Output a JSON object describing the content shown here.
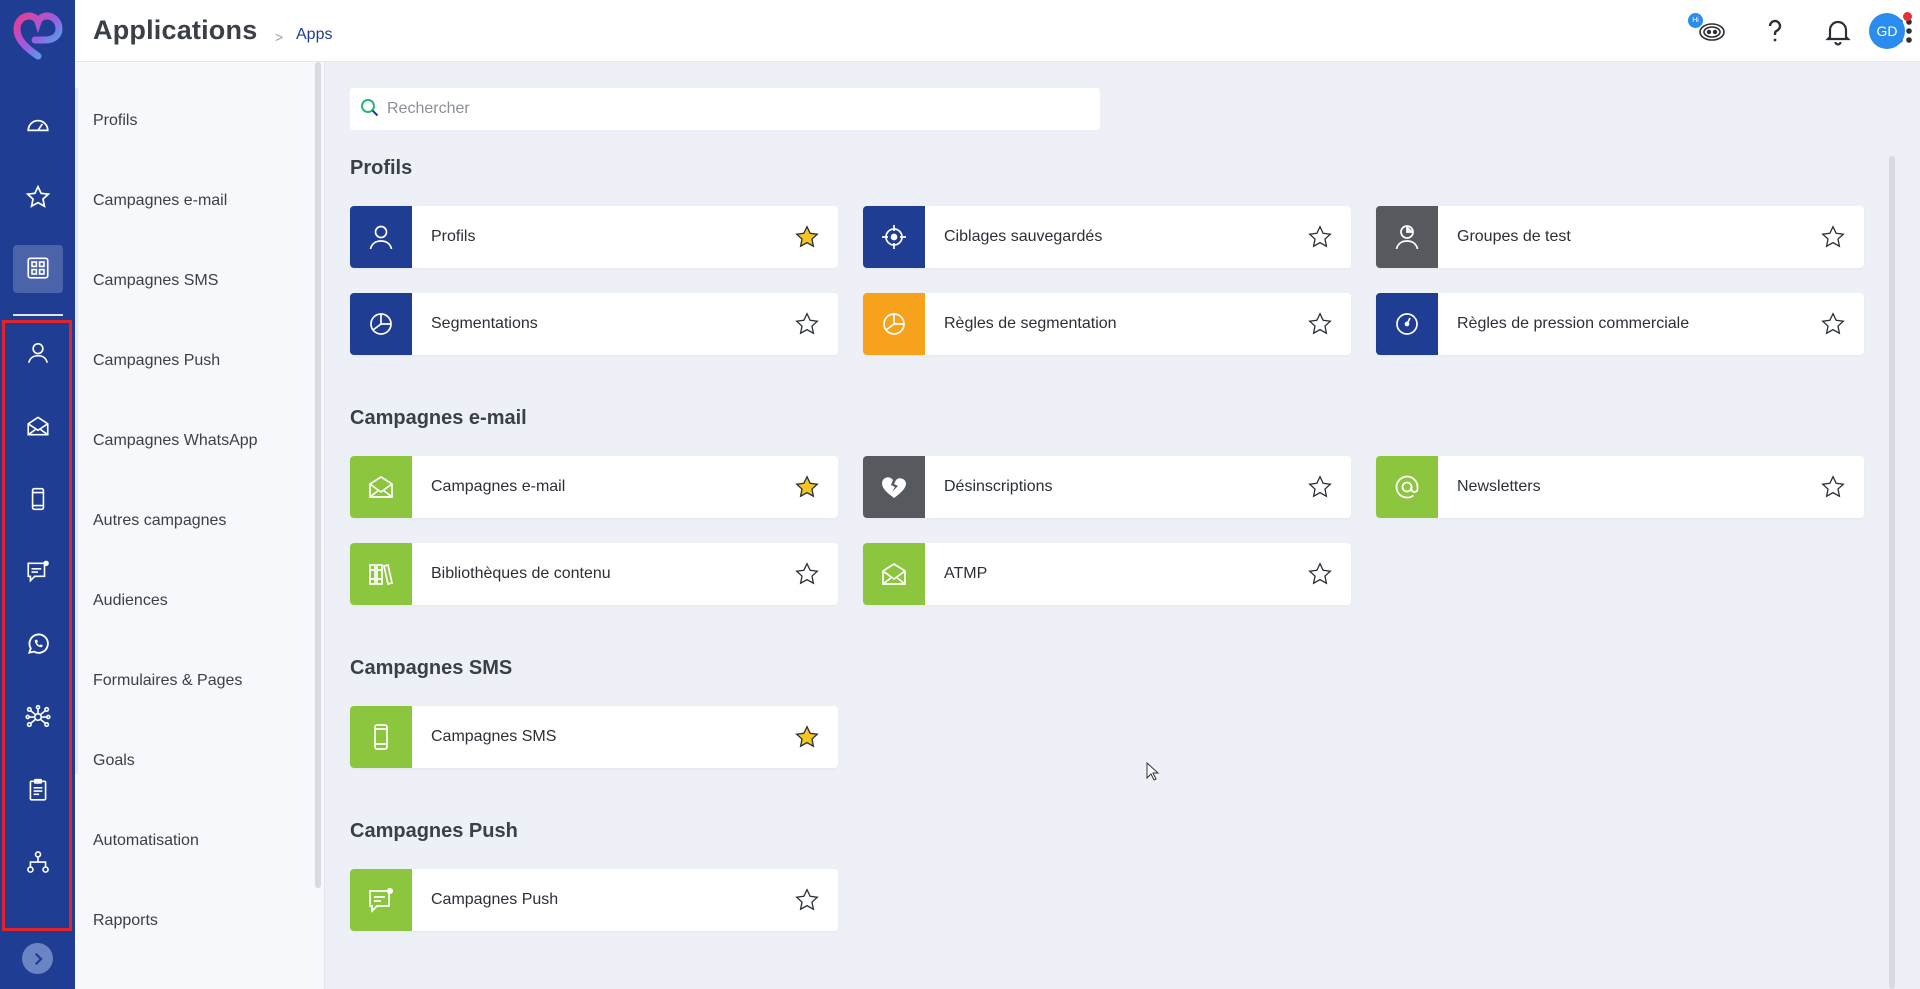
{
  "header": {
    "title": "Applications",
    "breadcrumb_sep": ">",
    "breadcrumb": "Apps",
    "hi_badge": "Hi",
    "avatar_initials": "GD",
    "icons": [
      "chatbot-icon",
      "help-icon",
      "bell-icon",
      "apps-grid-icon"
    ]
  },
  "rail": {
    "items": [
      "dashboard-icon",
      "star-icon",
      "apps-icon",
      "profile-icon",
      "email-icon",
      "mobile-icon",
      "push-icon",
      "whatsapp-icon",
      "audience-icon",
      "forms-icon",
      "automation-icon"
    ]
  },
  "categories": [
    "Profils",
    "Campagnes e-mail",
    "Campagnes SMS",
    "Campagnes Push",
    "Campagnes WhatsApp",
    "Autres campagnes",
    "Audiences",
    "Formulaires & Pages",
    "Goals",
    "Automatisation",
    "Rapports"
  ],
  "search": {
    "placeholder": "Rechercher",
    "value": ""
  },
  "colors": {
    "navy": "#1f3d92",
    "orange": "#f7a21d",
    "dark_gray": "#565a5e",
    "green": "#8cc63f",
    "star_fill": "#f3c623"
  },
  "sections": [
    {
      "title": "Profils",
      "cards": [
        {
          "label": "Profils",
          "icon": "user-icon",
          "color": "#1f3d92",
          "favorite": true
        },
        {
          "label": "Ciblages sauvegardés",
          "icon": "target-icon",
          "color": "#1f3d92",
          "favorite": false
        },
        {
          "label": "Groupes de test",
          "icon": "test-group-icon",
          "color": "#565a5e",
          "favorite": false
        },
        {
          "label": "Segmentations",
          "icon": "pie-icon",
          "color": "#1f3d92",
          "favorite": false
        },
        {
          "label": "Règles de segmentation",
          "icon": "pie-icon",
          "color": "#f7a21d",
          "favorite": false
        },
        {
          "label": "Règles de pression commerciale",
          "icon": "gauge-icon",
          "color": "#1f3d92",
          "favorite": false
        }
      ]
    },
    {
      "title": "Campagnes e-mail",
      "cards": [
        {
          "label": "Campagnes e-mail",
          "icon": "envelope-icon",
          "color": "#8cc63f",
          "favorite": true
        },
        {
          "label": "Désinscriptions",
          "icon": "broken-heart-icon",
          "color": "#565a5e",
          "favorite": false
        },
        {
          "label": "Newsletters",
          "icon": "at-icon",
          "color": "#8cc63f",
          "favorite": false
        },
        {
          "label": "Bibliothèques de contenu",
          "icon": "library-icon",
          "color": "#8cc63f",
          "favorite": false
        },
        {
          "label": "ATMP",
          "icon": "envelope-icon",
          "color": "#8cc63f",
          "favorite": false
        }
      ]
    },
    {
      "title": "Campagnes SMS",
      "cards": [
        {
          "label": "Campagnes SMS",
          "icon": "mobile-icon",
          "color": "#8cc63f",
          "favorite": true
        }
      ]
    },
    {
      "title": "Campagnes Push",
      "cards": [
        {
          "label": "Campagnes Push",
          "icon": "push-icon",
          "color": "#8cc63f",
          "favorite": false
        }
      ]
    }
  ]
}
